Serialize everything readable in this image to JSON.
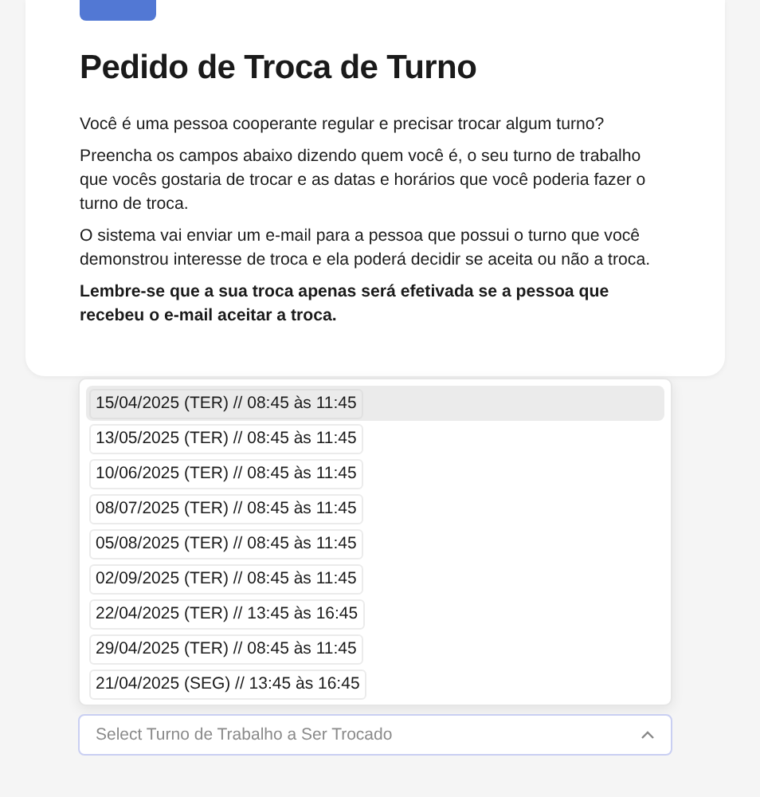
{
  "title": "Pedido de Troca de Turno",
  "paragraphs": [
    {
      "text": "Você é uma pessoa cooperante regular e precisar trocar algum turno?",
      "bold": false
    },
    {
      "text": "Preencha os campos abaixo dizendo quem você é, o seu turno de trabalho que vocês gostaria de trocar e as datas e horários que você poderia fazer o turno de troca.",
      "bold": false
    },
    {
      "text": "O sistema vai enviar um e-mail para a pessoa que possui o turno que você demonstrou interesse de troca e ela poderá decidir se aceita ou não a troca.",
      "bold": false
    },
    {
      "text": "Lembre-se que a sua troca apenas será efetivada se a pessoa que recebeu o e-mail aceitar a troca.",
      "bold": true
    }
  ],
  "dropdown": {
    "expanded": true,
    "options": [
      {
        "label": "15/04/2025 (TER) // 08:45 às 11:45",
        "highlighted": true
      },
      {
        "label": "13/05/2025 (TER) // 08:45 às 11:45",
        "highlighted": false
      },
      {
        "label": "10/06/2025 (TER) // 08:45 às 11:45",
        "highlighted": false
      },
      {
        "label": "08/07/2025 (TER) // 08:45 às 11:45",
        "highlighted": false
      },
      {
        "label": "05/08/2025 (TER) // 08:45 às 11:45",
        "highlighted": false
      },
      {
        "label": "02/09/2025 (TER) // 08:45 às 11:45",
        "highlighted": false
      },
      {
        "label": "22/04/2025 (TER) // 13:45 às 16:45",
        "highlighted": false
      },
      {
        "label": "29/04/2025 (TER) // 08:45 às 11:45",
        "highlighted": false
      },
      {
        "label": "21/04/2025 (SEG) // 13:45 às 16:45",
        "highlighted": false
      }
    ],
    "placeholder": "Select Turno de Trabalho a Ser Trocado"
  }
}
